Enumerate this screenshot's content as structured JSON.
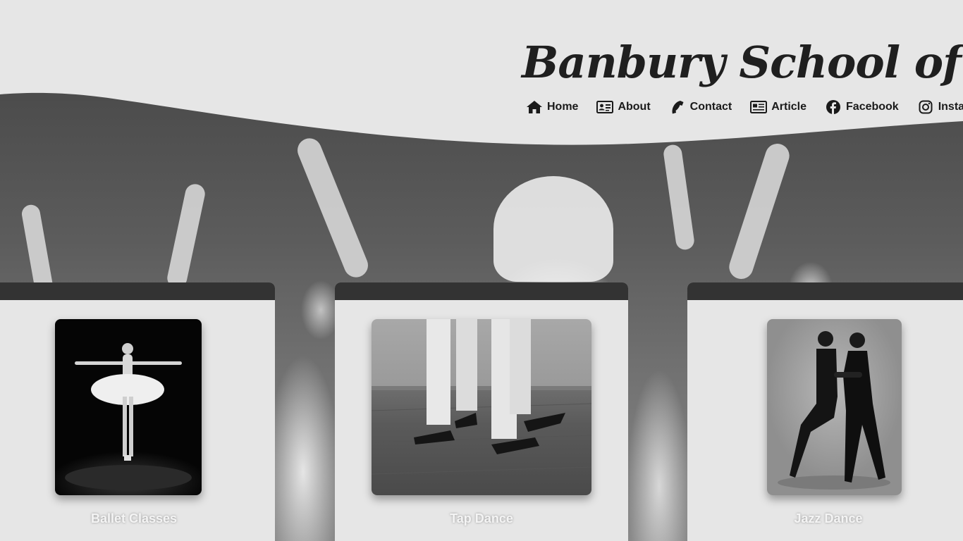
{
  "site": {
    "title": "Banbury School of Dance"
  },
  "nav": {
    "items": [
      {
        "label": "Home",
        "icon": "home-icon"
      },
      {
        "label": "About",
        "icon": "id-card-icon"
      },
      {
        "label": "Contact",
        "icon": "phone-icon"
      },
      {
        "label": "Article",
        "icon": "newspaper-icon"
      },
      {
        "label": "Facebook",
        "icon": "facebook-icon"
      },
      {
        "label": "Instagram",
        "icon": "instagram-icon"
      }
    ]
  },
  "cards": [
    {
      "caption": "Ballet Classes",
      "image": "ballerina-en-pointe-photo"
    },
    {
      "caption": "Tap Dance",
      "image": "tap-shoes-photo"
    },
    {
      "caption": "Jazz Dance",
      "image": "dance-couple-photo"
    }
  ],
  "colors": {
    "background": "#e6e6e6",
    "card_bar": "#333333",
    "text_dark": "#1a1a1a",
    "caption": "#f4f4f4"
  }
}
